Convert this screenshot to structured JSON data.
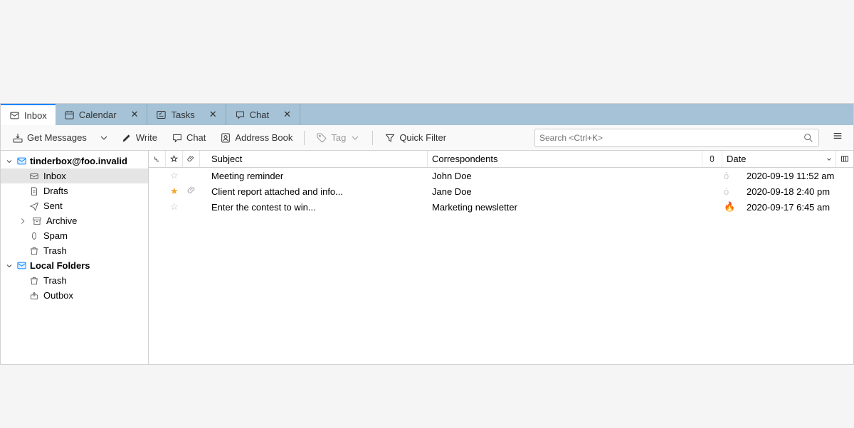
{
  "tabs": [
    {
      "label": "Inbox",
      "icon": "mail",
      "active": true,
      "closable": false
    },
    {
      "label": "Calendar",
      "icon": "calendar",
      "active": false,
      "closable": true
    },
    {
      "label": "Tasks",
      "icon": "tasks",
      "active": false,
      "closable": true
    },
    {
      "label": "Chat",
      "icon": "chat",
      "active": false,
      "closable": true
    }
  ],
  "toolbar": {
    "get_messages": "Get Messages",
    "write": "Write",
    "chat": "Chat",
    "address_book": "Address Book",
    "tag": "Tag",
    "quick_filter": "Quick Filter"
  },
  "search": {
    "placeholder": "Search <Ctrl+K>"
  },
  "sidebar": {
    "accounts": [
      {
        "name": "tinderbox@foo.invalid",
        "expanded": true,
        "folders": [
          {
            "name": "Inbox",
            "icon": "mail",
            "selected": true
          },
          {
            "name": "Drafts",
            "icon": "draft",
            "selected": false
          },
          {
            "name": "Sent",
            "icon": "sent",
            "selected": false
          },
          {
            "name": "Archive",
            "icon": "archive",
            "selected": false,
            "expandable": true
          },
          {
            "name": "Spam",
            "icon": "spam",
            "selected": false
          },
          {
            "name": "Trash",
            "icon": "trash",
            "selected": false
          }
        ]
      },
      {
        "name": "Local Folders",
        "expanded": true,
        "folders": [
          {
            "name": "Trash",
            "icon": "trash",
            "selected": false
          },
          {
            "name": "Outbox",
            "icon": "outbox",
            "selected": false
          }
        ]
      }
    ]
  },
  "columns": {
    "subject": "Subject",
    "correspondents": "Correspondents",
    "date": "Date"
  },
  "messages": [
    {
      "starred": false,
      "attachment": false,
      "subject": "Meeting reminder",
      "correspondent": "John Doe",
      "spam": false,
      "date": "2020-09-19 11:52 am"
    },
    {
      "starred": true,
      "attachment": true,
      "subject": "Client report attached and info...",
      "correspondent": "Jane Doe",
      "spam": false,
      "date": "2020-09-18 2:40 pm"
    },
    {
      "starred": false,
      "attachment": false,
      "subject": "Enter the contest to win...",
      "correspondent": "Marketing newsletter",
      "spam": true,
      "date": "2020-09-17 6:45 am"
    }
  ]
}
